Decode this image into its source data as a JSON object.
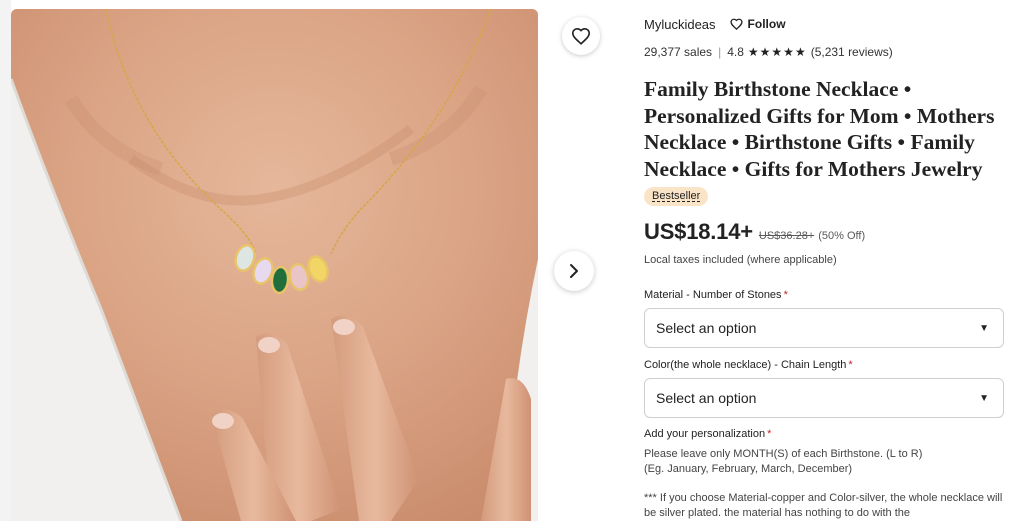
{
  "gallery": {
    "favorite_icon": "heart-outline-icon",
    "next_icon": "chevron-right-icon"
  },
  "shop": {
    "name": "Myluckideas",
    "follow_label": "Follow",
    "follow_icon": "heart-outline-icon"
  },
  "rating": {
    "sales": "29,377 sales",
    "score": "4.8",
    "stars": 5,
    "reviews": "(5,231 reviews)"
  },
  "product": {
    "title": "Family Birthstone Necklace • Personalized Gifts for Mom • Mothers Necklace • Birthstone Gifts • Family Necklace • Gifts for Mothers Jewelry",
    "badge": "Bestseller",
    "price": "US$18.14+",
    "original_price": "US$36.28+",
    "discount": "(50% Off)",
    "taxes": "Local taxes included (where applicable)"
  },
  "options": [
    {
      "label": "Material - Number of Stones",
      "required_mark": "*",
      "value": "Select an option"
    },
    {
      "label": "Color(the whole necklace) - Chain Length",
      "required_mark": "*",
      "value": "Select an option"
    }
  ],
  "personalization": {
    "label": "Add your personalization",
    "required_mark": "*",
    "instructions_1": "Please leave only MONTH(S) of each Birthstone. (L to R)",
    "instructions_2": "(Eg. January, February, March, December)",
    "note": "*** If you choose Material-copper and Color-silver, the whole necklace will be silver plated. the material has nothing to do with the"
  },
  "colors": {
    "required": "#c2262e",
    "badge_bg": "#fae4c7",
    "text": "#222222"
  }
}
